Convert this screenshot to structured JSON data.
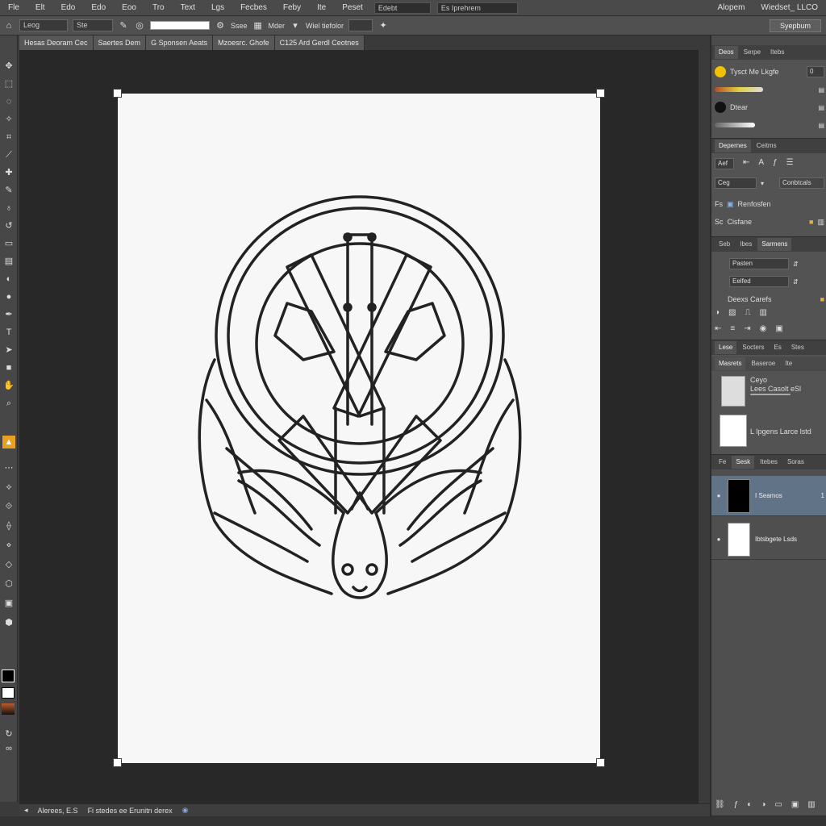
{
  "menu": {
    "items": [
      "Fle",
      "Elt",
      "Edo",
      "Edo",
      "Eoo",
      "Tro",
      "Text",
      "Lgs",
      "Fecbes",
      "Feby",
      "Ite",
      "Peset"
    ],
    "field_1": "Edebt",
    "field_2": "Es Iprehrem",
    "right_label": "Alopem",
    "right_label_2": "Wiedset_ LLCO"
  },
  "options_bar": {
    "field_1": "Leog",
    "field_2": "Ste",
    "label_1": "Ssee",
    "label_2": "Mder",
    "label_3": "Wiel tiefolor",
    "right_button": "Syepbum"
  },
  "doc_tabs": [
    "Hesas Deoram Cec",
    "Saertes Dem",
    "G Sponsen Aeats",
    "Mzoesrc. Ghofe",
    "C125 Ard Gerdl Ceotnes"
  ],
  "status": {
    "zoom": "Alerees, E.S",
    "info": "Fi stedes ee Erunitn derex"
  },
  "panels": {
    "color": {
      "tabs": [
        "Deos",
        "Serpe",
        "Itebs"
      ],
      "swatch_1_label": "Tysct Me Lkgfe",
      "swatch_1_value": "0",
      "swatch_3_label": "Dtear",
      "swatch_1_color": "#f2c200",
      "swatch_3_color": "#111111"
    },
    "properties": {
      "tabs": [
        "Depernes",
        "Ceitms"
      ],
      "field_1": "Aef",
      "field_2": "Ceg",
      "button": "Conbtcals",
      "row_1": "Fs",
      "row_1_label": "Renfosfen",
      "row_2": "Sc",
      "row_2_label": "Cisfane"
    },
    "paths": {
      "tabs": [
        "Seb",
        "Ibes",
        "Sarmens"
      ],
      "field_1": "Pasten",
      "field_2": "Eelfed",
      "label": "Deexs Carefs"
    },
    "history": {
      "tabs": [
        "Lese",
        "Socters",
        "Es",
        "Stes"
      ],
      "subtabs": [
        "Masrets",
        "Baseroe",
        "Ite"
      ],
      "item_1_title": "Ceyo",
      "item_1_sub": "Lees Casolt eSl",
      "item_2_title": "L Ipgens Larce lstd"
    },
    "layers": {
      "tabs": [
        "Fe",
        "Sesk",
        "Itebes",
        "Soras"
      ],
      "layer_1": "I Seamos",
      "layer_1_value": "1",
      "layer_2": "Ibtsbgete Lsds"
    }
  },
  "colors": {
    "selected_layer": "#617386",
    "canvas_bg": "#282828",
    "artboard": "#f7f7f7"
  }
}
